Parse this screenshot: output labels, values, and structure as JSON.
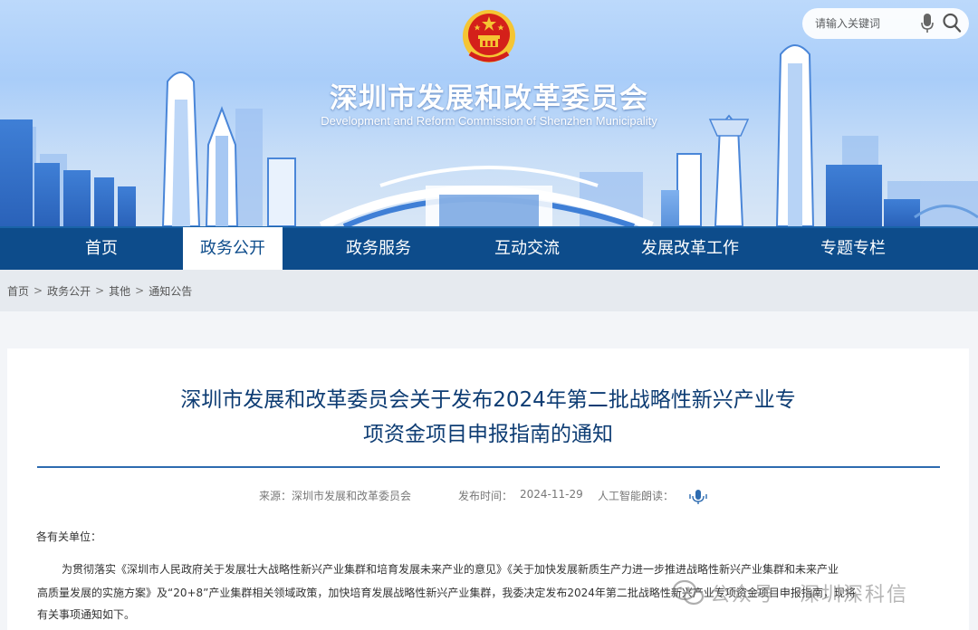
{
  "header": {
    "title": "深圳市发展和改革委员会",
    "subtitle": "Development and Reform Commission of Shenzhen Municipality",
    "search_placeholder": "请输入关键词"
  },
  "nav": {
    "items": [
      {
        "label": "首页"
      },
      {
        "label": "政务公开",
        "active": true
      },
      {
        "label": "政务服务"
      },
      {
        "label": "互动交流"
      },
      {
        "label": "发展改革工作"
      },
      {
        "label": "专题专栏"
      }
    ]
  },
  "breadcrumb": [
    "首页",
    "政务公开",
    "其他",
    "通知公告"
  ],
  "breadcrumb_sep": ">",
  "article": {
    "title_line1": "深圳市发展和改革委员会关于发布2024年第二批战略性新兴产业专",
    "title_line2": "项资金项目申报指南的通知",
    "source_label": "来源：",
    "source": "深圳市发展和改革委员会",
    "date_label": "发布时间：",
    "date": "2024-11-29",
    "tts_label": "人工智能朗读：",
    "greeting": "各有关单位：",
    "para_line1": "为贯彻落实《深圳市人民政府关于发展壮大战略性新兴产业集群和培育发展未来产业的意见》《关于加快发展新质生产力进一步推进战略性新兴产业集群和未来产业",
    "para_line2": "高质量发展的实施方案》及“20+8”产业集群相关领域政策，加快培育发展战略性新兴产业集群，我委决定发布2024年第二批战略性新兴产业专项资金项目申报指南，现将",
    "para_line3": "有关事项通知如下。"
  },
  "watermark": "公众号 · 深圳深科信",
  "colors": {
    "nav_bg": "#0d4c8b",
    "title_blue": "#0d3c73",
    "rule_blue": "#2d6bb0",
    "emblem_red": "#d4201a",
    "emblem_gold": "#f5c533"
  }
}
